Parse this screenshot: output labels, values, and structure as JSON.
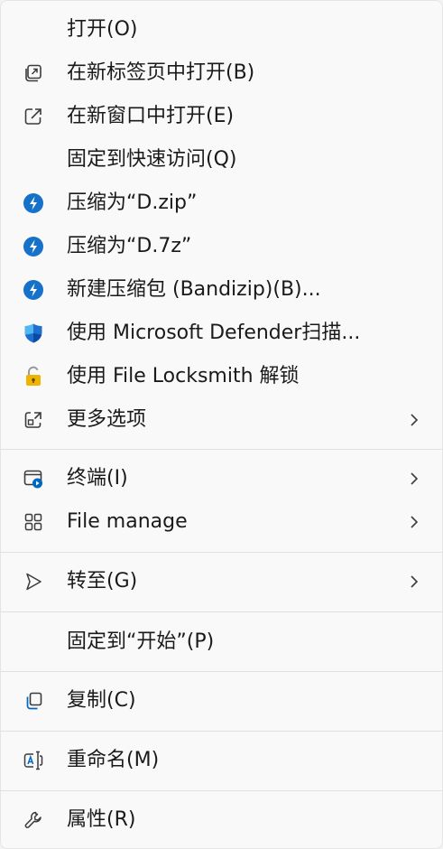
{
  "menu": {
    "items": [
      {
        "label": "打开(O)"
      },
      {
        "label": "在新标签页中打开(B)"
      },
      {
        "label": "在新窗口中打开(E)"
      },
      {
        "label": "固定到快速访问(Q)"
      },
      {
        "label": "压缩为“D.zip”"
      },
      {
        "label": "压缩为“D.7z”"
      },
      {
        "label": "新建压缩包 (Bandizip)(B)..."
      },
      {
        "label": "使用 Microsoft Defender扫描..."
      },
      {
        "label": "使用 File Locksmith 解锁"
      },
      {
        "label": "更多选项"
      },
      {
        "label": "终端(I)"
      },
      {
        "label": "File manage"
      },
      {
        "label": "转至(G)"
      },
      {
        "label": "固定到“开始”(P)"
      },
      {
        "label": "复制(C)"
      },
      {
        "label": "重命名(M)"
      },
      {
        "label": "属性(R)"
      }
    ]
  },
  "colors": {
    "accent": "#0067c0",
    "icon_gray": "#3b3b3b",
    "text": "#1a1a1a",
    "separator": "#e0e0e0"
  }
}
